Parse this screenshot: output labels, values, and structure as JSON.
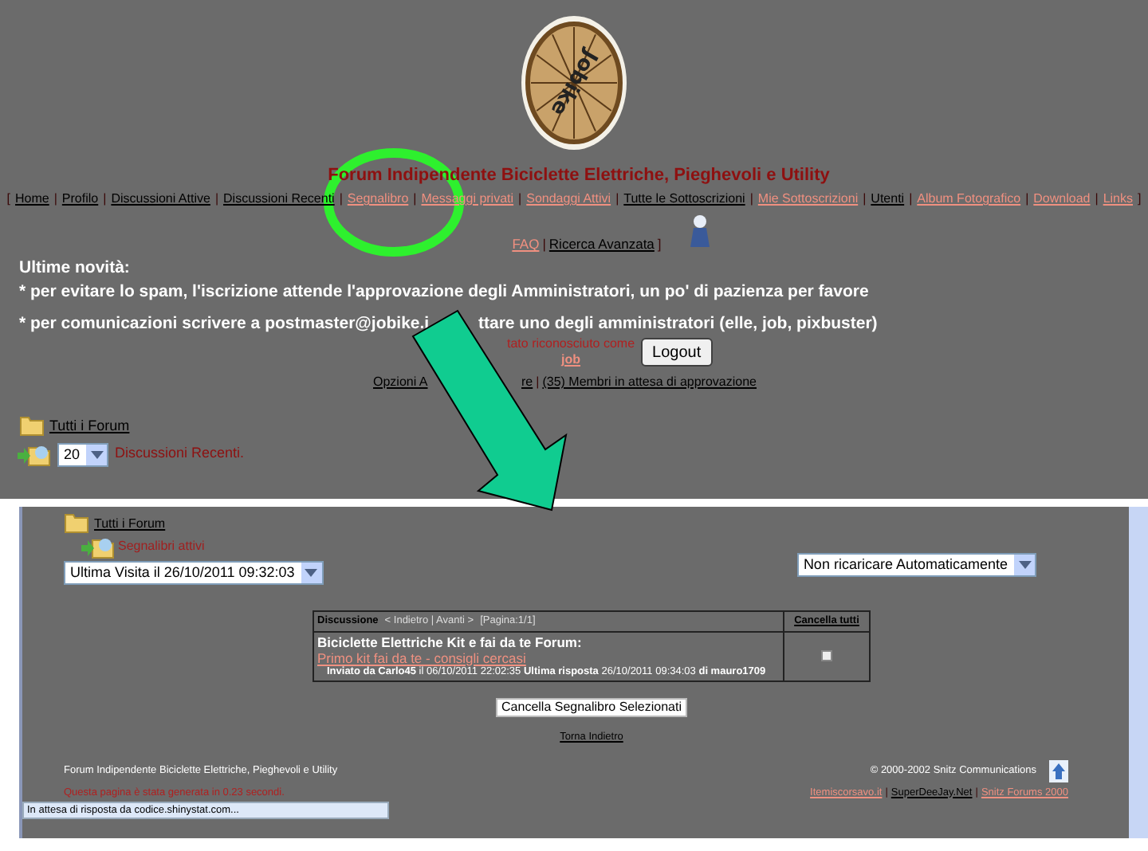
{
  "logo": {
    "text": "Jobike"
  },
  "title": "Forum Indipendente Biciclette Elettriche, Pieghevoli e Utility",
  "nav": {
    "open": "[",
    "close": "]",
    "items": [
      {
        "label": "Home",
        "visited": false,
        "sep": "|"
      },
      {
        "label": "Profilo",
        "visited": false,
        "sep": "|"
      },
      {
        "label": "Discussioni Attive",
        "visited": false,
        "sep": "|"
      },
      {
        "label": "Discussioni Recenti",
        "visited": false,
        "sep": "|"
      },
      {
        "label": "Segnalibro",
        "visited": true,
        "sep": "|"
      },
      {
        "label": "Messaggi privati",
        "visited": true,
        "sep": "|"
      },
      {
        "label": "Sondaggi Attivi",
        "visited": true,
        "sep": "|"
      },
      {
        "label": "Tutte le Sottoscrizioni",
        "visited": false,
        "sep": "|"
      },
      {
        "label": "Mie Sottoscrizioni",
        "visited": true,
        "sep": "|"
      },
      {
        "label": "Utenti",
        "visited": false,
        "sep": "|"
      },
      {
        "label": "Album Fotografico",
        "visited": true,
        "sep": "|"
      },
      {
        "label": "Download",
        "visited": true,
        "sep": "|"
      },
      {
        "label": "Links",
        "visited": true
      }
    ]
  },
  "help": {
    "faq": "FAQ",
    "sep": "|",
    "search": "Ricerca Avanzata",
    "close": "]"
  },
  "news": {
    "heading": "Ultime novità:",
    "line_1": "* per evitare lo spam, l'iscrizione attende l'approvazione degli Amministratori, un po' di pazienza per favore",
    "line_2_start": "* per comunicazioni scrivere a postmaster@jobike.i",
    "line_2_end": "ttare uno degli amministratori (elle, job, pixbuster)"
  },
  "login": {
    "message": "tato riconosciuto come",
    "user": "job",
    "button": "Logout"
  },
  "admin": {
    "options": "Opzioni A",
    "options_end": "re",
    "sep": "|",
    "pending": "(35) Membri in attesa di approvazione"
  },
  "all_forums": "Tutti i Forum",
  "recent": {
    "count": "20",
    "label": "Discussioni Recenti."
  },
  "window": {
    "all_forums": "Tutti i Forum",
    "bookmarks": "Segnalibri attivi",
    "last_visit": "Ultima Visita il 26/10/2011 09:32:03",
    "reload": "Non ricaricare Automaticamente",
    "table": {
      "heading": "Discussione",
      "pager": "< Indietro | Avanti >",
      "page": "[Pagina:1/1]",
      "clear_all": "Cancella tutti",
      "rows": [
        {
          "forum": "Biciclette Elettriche Kit e fai da te Forum:",
          "topic": "Primo kit fai da te - consigli cercasi",
          "info": "**Inviato da Carlo45** il 06/10/2011 22:02:35   **Ultima risposta** 26/10/2011 09:34:03 **di mauro1709**",
          "checked": false
        }
      ]
    },
    "delete_button": "Cancella Segnalibro Selezionati",
    "back": "Torna Indietro",
    "footer_title": "Forum Indipendente Biciclette Elettriche, Pieghevoli e Utility",
    "copyright": "© 2000-2002 Snitz Communications",
    "generated": "Questa pagina è stata generata in 0.23 secondi.",
    "links": [
      {
        "label": "Itemiscorsavo.it",
        "visited": true,
        "sep": "|"
      },
      {
        "label": "SuperDeeJay.Net",
        "visited": false,
        "sep": "|"
      },
      {
        "label": "Snitz Forums 2000",
        "visited": true
      }
    ],
    "status": "In attesa di risposta da codice.shinystat.com..."
  }
}
